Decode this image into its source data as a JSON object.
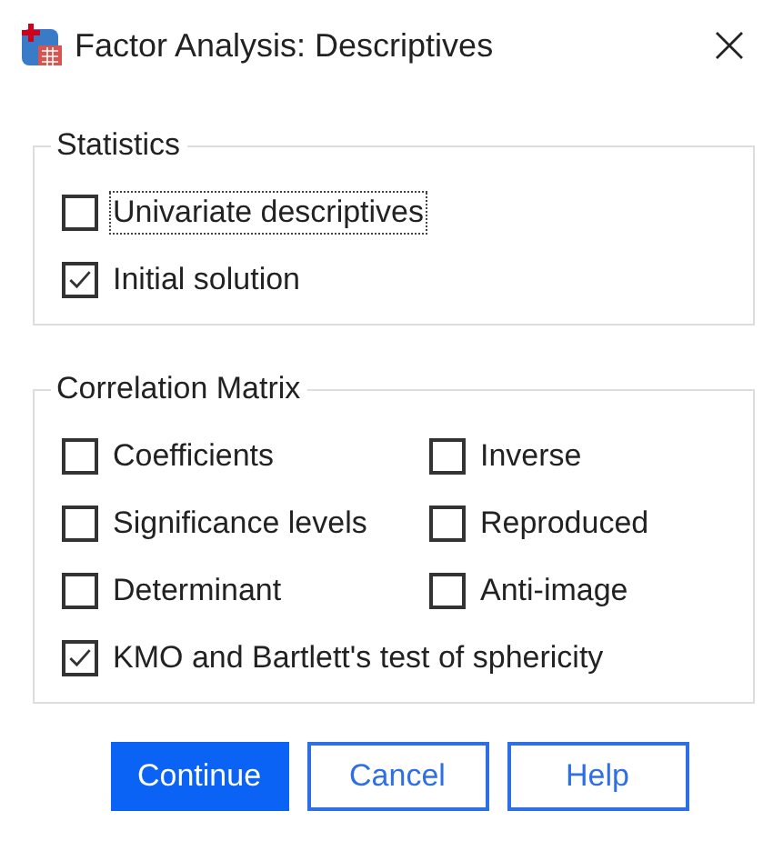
{
  "window": {
    "title": "Factor Analysis: Descriptives"
  },
  "groups": [
    {
      "title": "Statistics",
      "rows": [
        [
          {
            "label": "Univariate descriptives",
            "checked": false,
            "focused": true
          }
        ],
        [
          {
            "label": "Initial solution",
            "checked": true,
            "focused": false
          }
        ]
      ]
    },
    {
      "title": "Correlation Matrix",
      "rows": [
        [
          {
            "label": "Coefficients",
            "checked": false,
            "focused": false
          },
          {
            "label": "Inverse",
            "checked": false,
            "focused": false
          }
        ],
        [
          {
            "label": "Significance levels",
            "checked": false,
            "focused": false
          },
          {
            "label": "Reproduced",
            "checked": false,
            "focused": false
          }
        ],
        [
          {
            "label": "Determinant",
            "checked": false,
            "focused": false
          },
          {
            "label": "Anti-image",
            "checked": false,
            "focused": false
          }
        ],
        [
          {
            "label": "KMO and Bartlett's test of sphericity",
            "checked": true,
            "focused": false
          }
        ]
      ]
    }
  ],
  "buttons": [
    {
      "label": "Continue",
      "default": true
    },
    {
      "label": "Cancel",
      "default": false
    },
    {
      "label": "Help",
      "default": false
    }
  ]
}
